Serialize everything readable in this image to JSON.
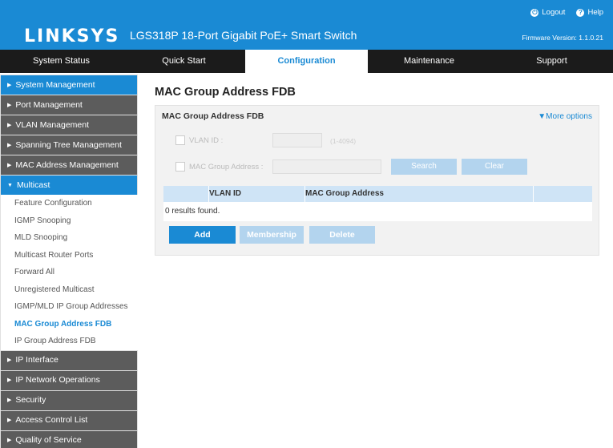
{
  "header": {
    "logo": "LINKSYS",
    "product": "LGS318P 18-Port Gigabit PoE+ Smart Switch",
    "logout_label": "Logout",
    "help_label": "Help",
    "firmware": "Firmware Version: 1.1.0.21",
    "brand_color": "#1a8ad4"
  },
  "nav": {
    "tabs": [
      "System Status",
      "Quick Start",
      "Configuration",
      "Maintenance",
      "Support"
    ],
    "active": "Configuration"
  },
  "sidebar": {
    "sections_top": [
      "System Management",
      "Port Management",
      "VLAN Management",
      "Spanning Tree Management",
      "MAC Address Management",
      "Multicast"
    ],
    "multicast_items": [
      "Feature Configuration",
      "IGMP Snooping",
      "MLD Snooping",
      "Multicast Router Ports",
      "Forward All",
      "Unregistered Multicast",
      "IGMP/MLD IP Group Addresses",
      "MAC Group Address FDB",
      "IP Group Address FDB"
    ],
    "sections_bottom": [
      "IP Interface",
      "IP Network Operations",
      "Security",
      "Access Control List",
      "Quality of Service"
    ],
    "current_item": "MAC Group Address FDB"
  },
  "main": {
    "page_title": "MAC Group Address FDB",
    "panel_title": "MAC Group Address FDB",
    "more_options": "▼More options",
    "filter": {
      "vlan_label": "VLAN ID :",
      "vlan_hint": "(1-4094)",
      "mac_label": "MAC Group Address :",
      "search_label": "Search",
      "clear_label": "Clear"
    },
    "table": {
      "columns": [
        "VLAN ID",
        "MAC Group Address"
      ],
      "results_text": "0 results found."
    },
    "actions": {
      "add": "Add",
      "membership": "Membership",
      "delete": "Delete"
    }
  }
}
